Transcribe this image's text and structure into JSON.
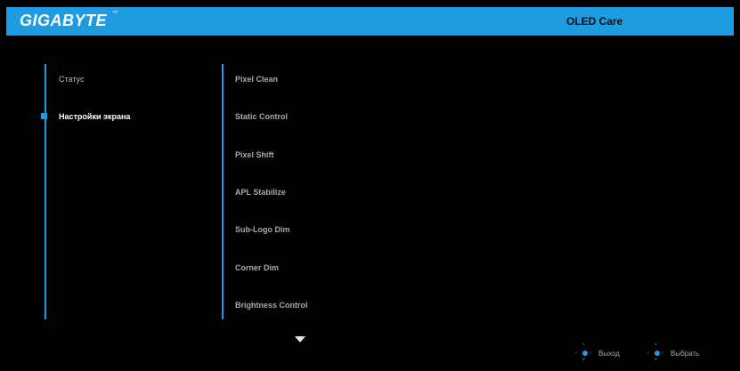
{
  "header": {
    "brand": "GIGABYTE",
    "trademark": "™",
    "section_title": "OLED Care",
    "accent_color": "#1f9be0"
  },
  "left_menu": {
    "items": [
      {
        "label": "Статус",
        "active": false
      },
      {
        "label": "Настройки экрана",
        "active": true
      }
    ]
  },
  "sub_menu": {
    "items": [
      {
        "label": "Pixel Clean"
      },
      {
        "label": "Static Control"
      },
      {
        "label": "Pixel Shift"
      },
      {
        "label": "APL Stabilize"
      },
      {
        "label": "Sub-Logo Dim"
      },
      {
        "label": "Corner Dim"
      },
      {
        "label": "Brightness Control"
      }
    ],
    "more_indicator": "down-arrow-icon"
  },
  "footer": {
    "hints": [
      {
        "icon": "joystick-icon",
        "label": "Выход"
      },
      {
        "icon": "joystick-icon",
        "label": "Выбрать"
      }
    ]
  }
}
